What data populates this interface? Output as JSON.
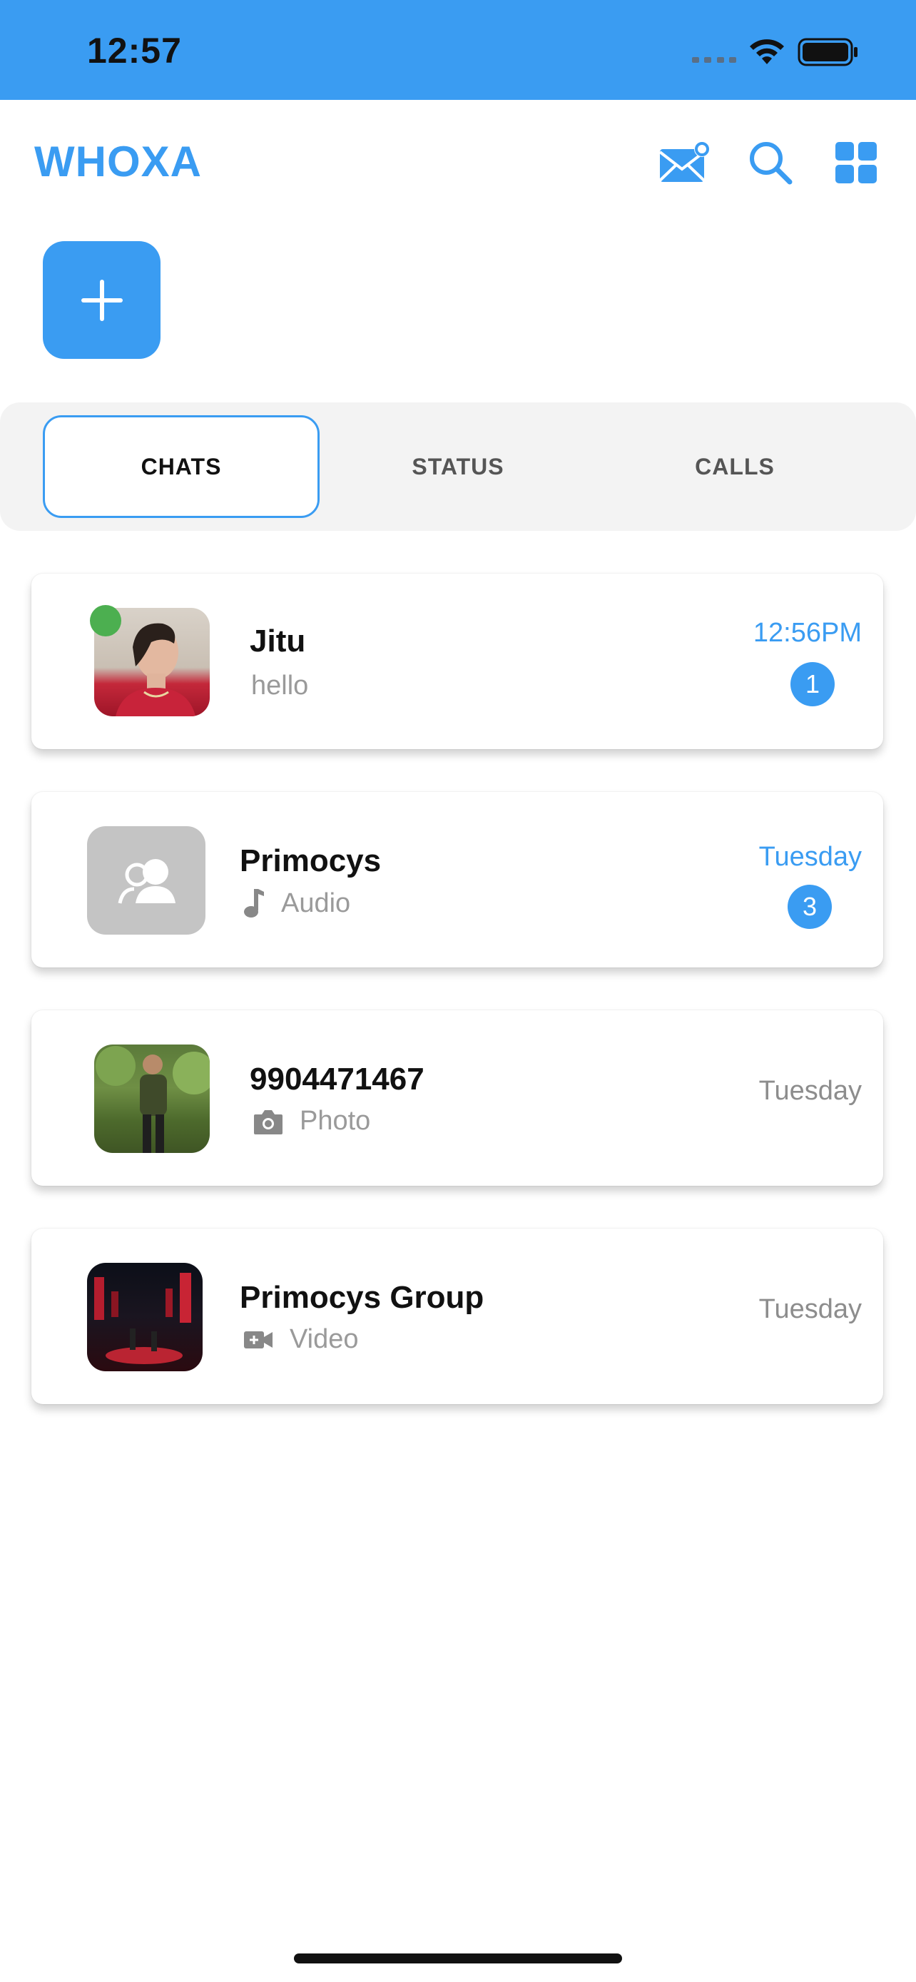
{
  "status_bar": {
    "time": "12:57"
  },
  "header": {
    "brand": "WHOXA",
    "icons": [
      "mail-notification-icon",
      "search-icon",
      "grid-menu-icon"
    ]
  },
  "fab": {
    "icon": "plus-icon",
    "label": "+"
  },
  "tabs": [
    {
      "label": "CHATS",
      "active": true
    },
    {
      "label": "STATUS",
      "active": false
    },
    {
      "label": "CALLS",
      "active": false
    }
  ],
  "chats": [
    {
      "name": "Jitu",
      "preview": "hello",
      "preview_icon": "",
      "time": "12:56PM",
      "unread": "1",
      "online": true
    },
    {
      "name": "Primocys",
      "preview": "Audio",
      "preview_icon": "music-note-icon",
      "time": "Tuesday",
      "unread": "3",
      "online": false
    },
    {
      "name": "9904471467",
      "preview": "Photo",
      "preview_icon": "camera-icon",
      "time": "Tuesday",
      "unread": "",
      "online": false
    },
    {
      "name": "Primocys Group",
      "preview": "Video",
      "preview_icon": "video-camera-icon",
      "time": "Tuesday",
      "unread": "",
      "online": false
    }
  ],
  "colors": {
    "accent": "#3a9cf2",
    "online": "#4caf50",
    "muted": "#9a9a9a"
  }
}
